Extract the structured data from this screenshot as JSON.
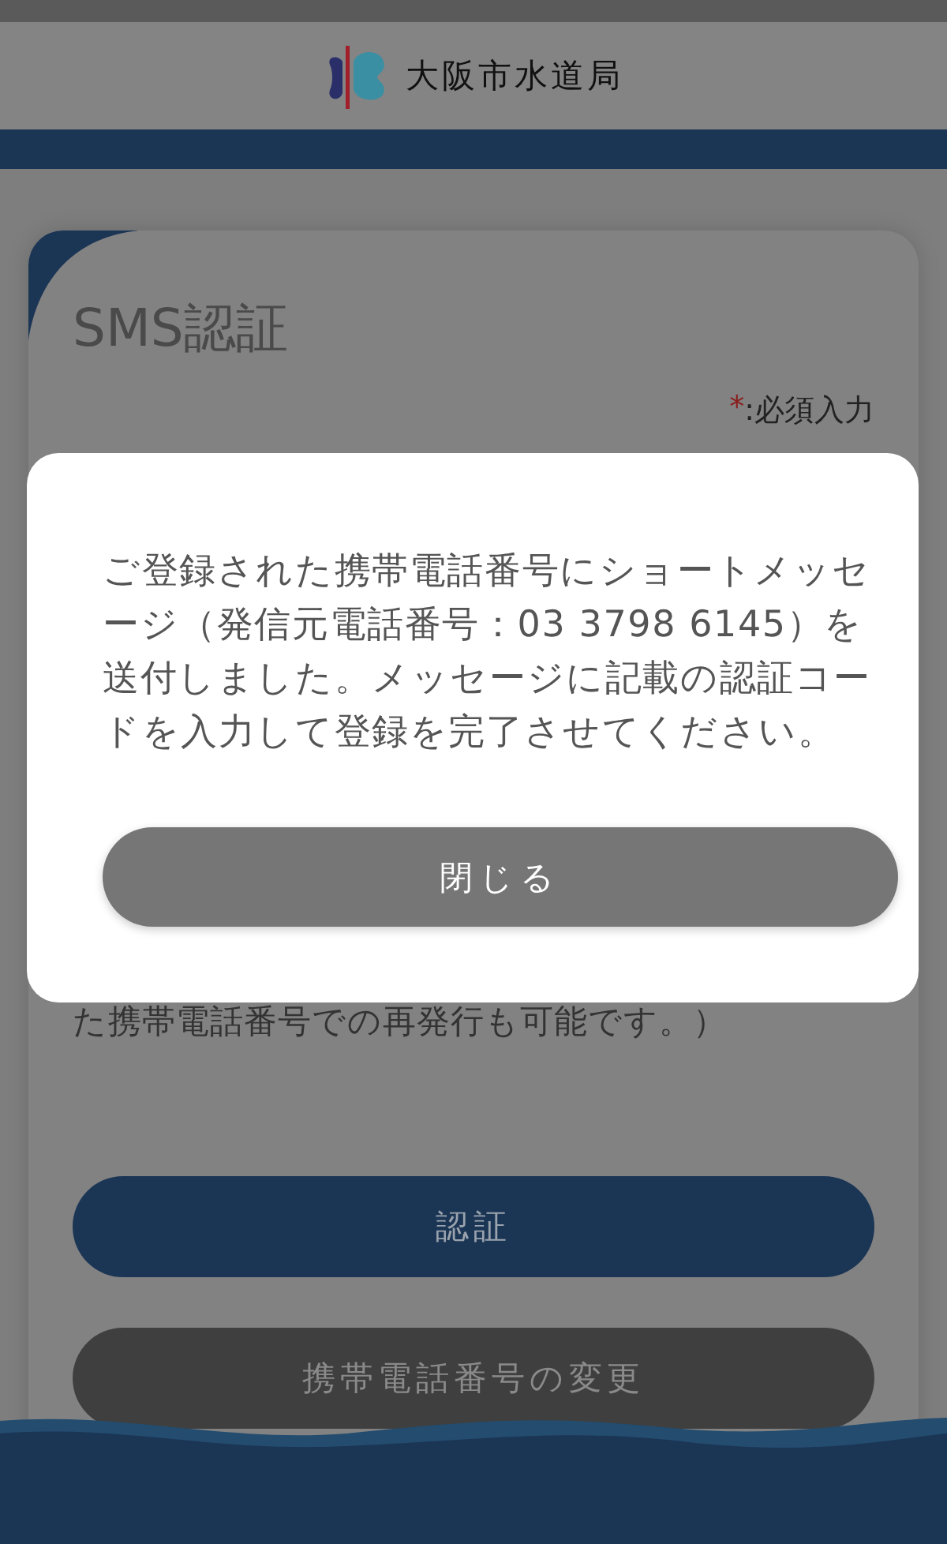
{
  "header": {
    "title": "大阪市水道局"
  },
  "card": {
    "title": "SMS認証",
    "required_mark": "*",
    "required_note": ":必須入力",
    "note_tail": "た携帯電話番号での再発行も可能です。）",
    "buttons": [
      {
        "label": "認証",
        "kind": "primary"
      },
      {
        "label": "携帯電話番号の変更",
        "kind": "secondary"
      }
    ]
  },
  "dialog": {
    "message": "ご登録された携帯電話番号にショートメッセージ（発信元電話番号：03 3798 6145）を送付しました。メッセージに記載の認証コードを入力して登録を完了させてください。",
    "button": "閉じる"
  }
}
